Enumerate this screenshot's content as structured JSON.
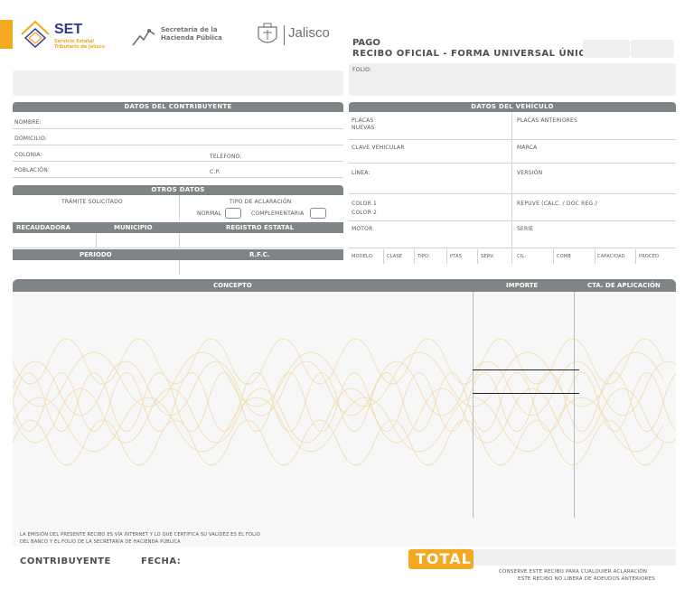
{
  "header": {
    "set_logo_text": "SET",
    "set_logo_sub1": "Servicio Estatal",
    "set_logo_sub2": "Tributario de Jalisco",
    "sec_logo_line1": "Secretaría de la",
    "sec_logo_line2": "Hacienda Pública",
    "jalisco_logo_text": "Jalisco",
    "title_line1": "PAGO",
    "title_line2": "RECIBO OFICIAL - FORMA UNIVERSAL ÚNICA",
    "folio_label": "FOLIO:"
  },
  "contribuyente": {
    "section_title": "DATOS DEL CONTRIBUYENTE",
    "nombre": "NOMBRE:",
    "domicilio": "DOMICILIO:",
    "colonia": "COLONIA:",
    "telefono": "TELÉFONO:",
    "poblacion": "POBLACIÓN:",
    "cp": "C.P."
  },
  "otros": {
    "section_title": "OTROS DATOS",
    "tramite": "TRÁMITE SOLICITADO",
    "tipo_aclaracion": "TIPO DE ACLARACIÓN",
    "normal": "NORMAL",
    "complementaria": "COMPLEMENTARIA"
  },
  "registro": {
    "recaudadora": "RECAUDADORA",
    "municipio": "MUNICIPIO",
    "registro_estatal": "REGISTRO ESTATAL",
    "periodo": "PERIODO",
    "rfc": "R.F.C."
  },
  "vehiculo": {
    "section_title": "DATOS DEL VEHÍCULO",
    "placas_nuevas_1": "PLACAS",
    "placas_nuevas_2": "NUEVAS",
    "placas_anteriores": "PLACAS ANTERIORES",
    "clave_vehicular": "CLAVE VEHICULAR",
    "marca": "MARCA",
    "linea": "LÍNEA:",
    "version": "VERSIÓN",
    "color1": "COLOR 1",
    "color2": "COLOR 2",
    "repuve": "REPUVE (CALC. / DOC REG.)",
    "motor": "MOTOR",
    "serie": "SERIE",
    "bottom_cols": [
      "MODELO:",
      "CLASE",
      "TIPO:",
      "PTAS",
      "SERV:",
      "CIL:",
      "COMB",
      "CAPACIDAD",
      "PROCED"
    ]
  },
  "concepto": {
    "concepto_header": "CONCEPTO",
    "importe_header": "IMPORTE",
    "cta_header": "CTA. DE APLICACIÓN"
  },
  "footer": {
    "notice_line1": "LA EMISIÓN DEL PRESENTE RECIBO ES VÍA INTERNET Y LO QUE CERTIFICA SU VALIDEZ ES EL FOLIO",
    "notice_line2": "DEL BANCO Y EL FOLIO DE LA SECRETARÍA DE HACIENDA PÚBLICA",
    "contribuyente": "CONTRIBUYENTE",
    "fecha": "FECHA:",
    "total": "TOTAL",
    "conserve_line1": "CONSERVE ESTE RECIBO PARA CUALQUIER ACLARACIÓN",
    "conserve_line2": "ESTE RECIBO NO LIBERA DE ADEUDOS ANTERIORES"
  },
  "colors": {
    "accent_orange": "#f2a81f",
    "header_grey": "#7f8487",
    "panel_grey": "#eeeff0",
    "guilloche": "#f1d9a6"
  }
}
